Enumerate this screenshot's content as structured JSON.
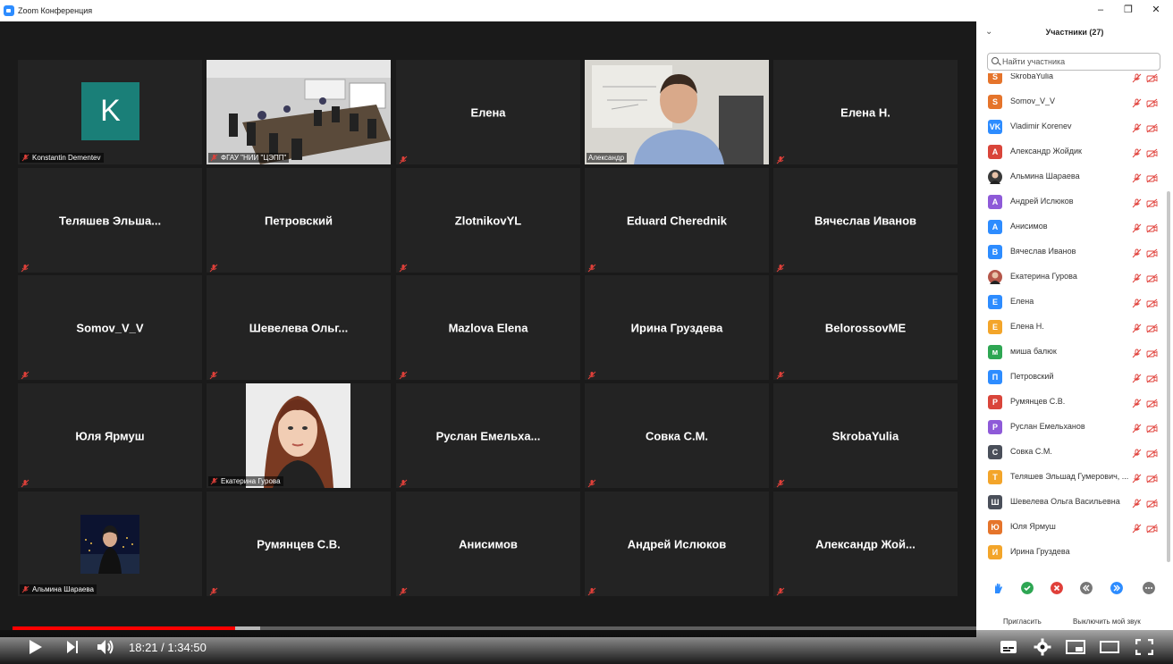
{
  "window": {
    "title": "Zoom Конференция"
  },
  "tiles": [
    {
      "name": "",
      "label": "Konstantin Dementev",
      "type": "avatar",
      "avatar_letter": "K"
    },
    {
      "name": "",
      "label": "ФГАУ \"НИИ \"ЦЭПП\"",
      "type": "video-room"
    },
    {
      "name": "Елена",
      "label": "",
      "type": "name"
    },
    {
      "name": "",
      "label": "Александр",
      "type": "video-person",
      "active": true
    },
    {
      "name": "Елена Н.",
      "label": "",
      "type": "name"
    },
    {
      "name": "Теляшев Эльша...",
      "label": "",
      "type": "name"
    },
    {
      "name": "Петровский",
      "label": "",
      "type": "name"
    },
    {
      "name": "ZlotnikovYL",
      "label": "",
      "type": "name"
    },
    {
      "name": "Eduard Cherednik",
      "label": "",
      "type": "name"
    },
    {
      "name": "Вячеслав Иванов",
      "label": "",
      "type": "name"
    },
    {
      "name": "Somov_V_V",
      "label": "",
      "type": "name"
    },
    {
      "name": "Шевелева Ольг...",
      "label": "",
      "type": "name"
    },
    {
      "name": "Mazlova Elena",
      "label": "",
      "type": "name"
    },
    {
      "name": "Ирина Груздева",
      "label": "",
      "type": "name"
    },
    {
      "name": "BelorossovME",
      "label": "",
      "type": "name"
    },
    {
      "name": "Юля Ярмуш",
      "label": "",
      "type": "name"
    },
    {
      "name": "",
      "label": "Екатерина Гурова",
      "type": "photo-woman"
    },
    {
      "name": "Руслан Емельха...",
      "label": "",
      "type": "name"
    },
    {
      "name": "Совка С.М.",
      "label": "",
      "type": "name"
    },
    {
      "name": "SkrobaYulia",
      "label": "",
      "type": "name"
    },
    {
      "name": "",
      "label": "Альмина Шараева",
      "type": "photo-city"
    },
    {
      "name": "Румянцев С.В.",
      "label": "",
      "type": "name"
    },
    {
      "name": "Анисимов",
      "label": "",
      "type": "name"
    },
    {
      "name": "Андрей Ислюков",
      "label": "",
      "type": "name"
    },
    {
      "name": "Александр Жой...",
      "label": "",
      "type": "name"
    }
  ],
  "participants": {
    "title": "Участники (27)",
    "search_placeholder": "Найти участника",
    "items": [
      {
        "initials": "S",
        "name": "SkrobaYulia",
        "color": "#e5742b",
        "muted": true
      },
      {
        "initials": "S",
        "name": "Somov_V_V",
        "color": "#e5742b",
        "muted": true
      },
      {
        "initials": "VK",
        "name": "Vladimir Korenev",
        "color": "#2d8cff",
        "muted": true
      },
      {
        "initials": "А",
        "name": "Александр Жойдик",
        "color": "#d9453a",
        "muted": true
      },
      {
        "initials": "",
        "name": "Альмина Шараева",
        "color": "#3a3a3a",
        "muted": true,
        "photo": true
      },
      {
        "initials": "А",
        "name": "Андрей Ислюков",
        "color": "#8e5ad8",
        "muted": true
      },
      {
        "initials": "А",
        "name": "Анисимов",
        "color": "#2d8cff",
        "muted": true
      },
      {
        "initials": "В",
        "name": "Вячеслав Иванов",
        "color": "#2d8cff",
        "muted": true
      },
      {
        "initials": "",
        "name": "Екатерина Гурова",
        "color": "#b5574a",
        "muted": true,
        "photo": true
      },
      {
        "initials": "Е",
        "name": "Елена",
        "color": "#2d8cff",
        "muted": true
      },
      {
        "initials": "Е",
        "name": "Елена Н.",
        "color": "#f3a52a",
        "muted": true
      },
      {
        "initials": "м",
        "name": "миша балюк",
        "color": "#2ea653",
        "muted": true
      },
      {
        "initials": "П",
        "name": "Петровский",
        "color": "#2d8cff",
        "muted": true
      },
      {
        "initials": "Р",
        "name": "Румянцев С.В.",
        "color": "#d9453a",
        "muted": true
      },
      {
        "initials": "Р",
        "name": "Руслан Емельханов",
        "color": "#8e5ad8",
        "muted": true
      },
      {
        "initials": "С",
        "name": "Совка С.М.",
        "color": "#4a4f5a",
        "muted": true
      },
      {
        "initials": "Т",
        "name": "Теляшев Эльшад Гумерович, ...",
        "color": "#f3a52a",
        "muted": true
      },
      {
        "initials": "Ш",
        "name": "Шевелева Ольга Васильевна",
        "color": "#4a4f5a",
        "muted": true
      },
      {
        "initials": "Ю",
        "name": "Юля Ярмуш",
        "color": "#e5742b",
        "muted": true
      },
      {
        "initials": "И",
        "name": "Ирина Груздева",
        "color": "#f3a52a",
        "muted": false
      }
    ],
    "footer": {
      "invite": "Пригласить",
      "mute_me": "Выключить мой звук"
    }
  },
  "player": {
    "time_current": "18:21",
    "time_separator": "/",
    "time_total": "1:34:50",
    "progress": 0.194,
    "buffered": 0.216
  },
  "colors": {
    "accent": "#2d8cff",
    "active_speaker": "#c8e84a",
    "muted_red": "#e0403a",
    "progress": "#ff0000"
  }
}
